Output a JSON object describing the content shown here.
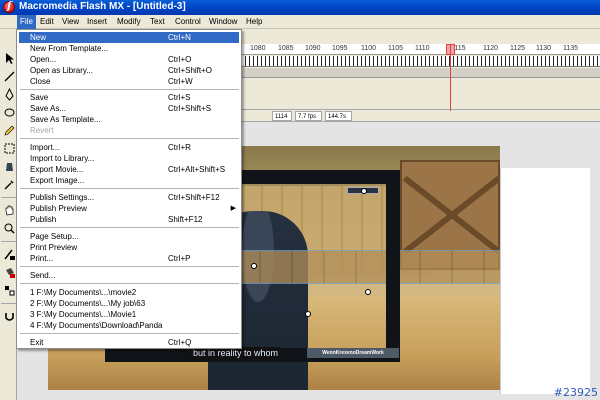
{
  "window": {
    "title": "Macromedia Flash MX - [Untitled-3]"
  },
  "menubar": [
    "File",
    "Edit",
    "View",
    "Insert",
    "Modify",
    "Text",
    "Control",
    "Window",
    "Help"
  ],
  "file_menu": [
    {
      "label": "New",
      "shortcut": "Ctrl+N"
    },
    {
      "label": "New From Template...",
      "shortcut": ""
    },
    {
      "label": "Open...",
      "shortcut": "Ctrl+O"
    },
    {
      "label": "Open as Library...",
      "shortcut": "Ctrl+Shift+O"
    },
    {
      "label": "Close",
      "shortcut": "Ctrl+W"
    },
    {
      "label": "Save",
      "shortcut": "Ctrl+S"
    },
    {
      "label": "Save As...",
      "shortcut": "Ctrl+Shift+S"
    },
    {
      "label": "Save As Template...",
      "shortcut": ""
    },
    {
      "label": "Revert",
      "shortcut": ""
    },
    {
      "label": "Import...",
      "shortcut": "Ctrl+R"
    },
    {
      "label": "Import to Library...",
      "shortcut": ""
    },
    {
      "label": "Export Movie...",
      "shortcut": "Ctrl+Alt+Shift+S"
    },
    {
      "label": "Export Image...",
      "shortcut": ""
    },
    {
      "label": "Publish Settings...",
      "shortcut": "Ctrl+Shift+F12"
    },
    {
      "label": "Publish Preview",
      "shortcut": ""
    },
    {
      "label": "Publish",
      "shortcut": "Shift+F12"
    },
    {
      "label": "Page Setup...",
      "shortcut": ""
    },
    {
      "label": "Print Preview",
      "shortcut": ""
    },
    {
      "label": "Print...",
      "shortcut": "Ctrl+P"
    },
    {
      "label": "Send...",
      "shortcut": ""
    },
    {
      "label": "1 F:\\My Documents\\...\\movie2",
      "shortcut": ""
    },
    {
      "label": "2 F:\\My Documents\\...\\My job\\63",
      "shortcut": ""
    },
    {
      "label": "3 F:\\My Documents\\...\\Movie1",
      "shortcut": ""
    },
    {
      "label": "4 F:\\My Documents\\Download\\Panda",
      "shortcut": ""
    },
    {
      "label": "Exit",
      "shortcut": "Ctrl+Q"
    }
  ],
  "timeline": {
    "ruler_ticks": [
      "1080",
      "1085",
      "1090",
      "1095",
      "1100",
      "1105",
      "1110",
      "1115",
      "1120",
      "1125",
      "1130",
      "1135"
    ],
    "current_frame": "1114",
    "fps": "7.7 fps",
    "time": "144.7s"
  },
  "stage": {
    "subtitle": "but in reality to whom",
    "watermark": "WennKrexenoDreamWork"
  },
  "badge": "#23925"
}
